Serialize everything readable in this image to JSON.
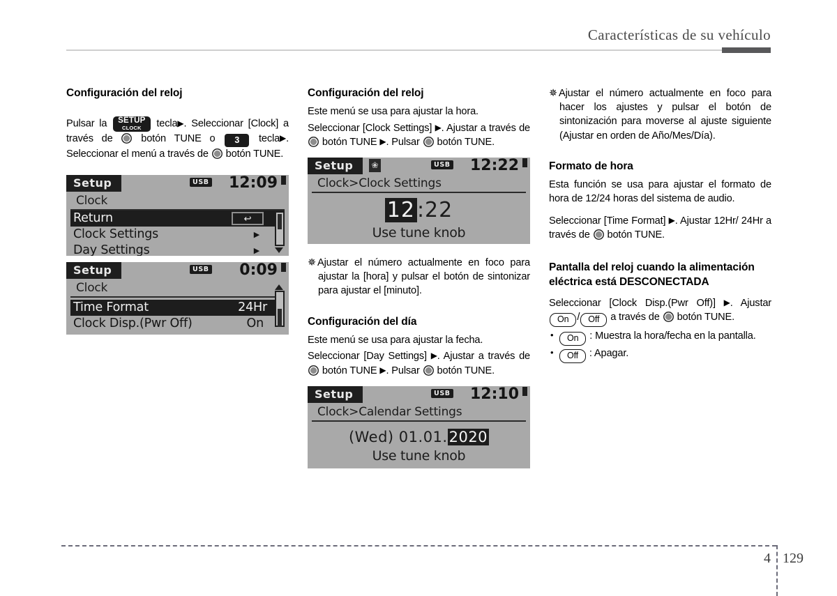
{
  "header": {
    "title": "Características de su vehículo"
  },
  "footer": {
    "chapter": "4",
    "page": "129"
  },
  "col1": {
    "heading": "Configuración del reloj",
    "para_pre": "Pulsar la",
    "key_setup_line1": "SETUP",
    "key_setup_line2": "CLOCK",
    "para_mid1": "tecla",
    "para_mid2": ". Seleccionar [Clock] a través de",
    "para_mid3": "botón TUNE o",
    "key_num": "3",
    "para_mid4": "tecla",
    "para_mid5": ". Seleccionar el menú a través de",
    "para_end": "botón TUNE."
  },
  "lcd1": {
    "title": "Setup",
    "usb": "USB",
    "clock": "12:09",
    "path": "Clock",
    "rows": [
      {
        "label": "Return",
        "value": "↩",
        "selected": true
      },
      {
        "label": "Clock Settings",
        "value": "▶",
        "selected": false
      },
      {
        "label": "Day Settings",
        "value": "▶",
        "selected": false
      }
    ]
  },
  "lcd2": {
    "title": "Setup",
    "usb": "USB",
    "clock": "0:09",
    "path": "Clock",
    "rows": [
      {
        "label": "Time Format",
        "value": "24Hr",
        "selected": true
      },
      {
        "label": "Clock Disp.(Pwr Off)",
        "value": "On",
        "selected": false
      }
    ]
  },
  "col2": {
    "heading1": "Configuración del reloj",
    "p1": "Este menú se usa para ajustar la hora.",
    "p2_a": "Seleccionar [Clock Settings]",
    "p2_b": ". Ajustar a través de",
    "p2_c": "botón TUNE",
    "p2_d": ". Pulsar",
    "p2_e": "botón TUNE.",
    "note1": "Ajustar el número actualmente en foco para ajustar la [hora] y pulsar el botón de sintonizar para ajustar el [minuto].",
    "heading2": "Configuración del día",
    "p3": "Este menú se usa para ajustar la fecha.",
    "p4_a": "Seleccionar [Day Settings]",
    "p4_b": ". Ajustar a través de",
    "p4_c": "botón TUNE",
    "p4_d": ". Pulsar",
    "p4_e": "botón TUNE."
  },
  "lcd3": {
    "title": "Setup",
    "bluetooth": "bluetooth-icon",
    "usb": "USB",
    "clock": "12:22",
    "path": "Clock>Clock Settings",
    "time_highlight": "12",
    "time_rest": ":22",
    "hint": "Use tune knob"
  },
  "lcd4": {
    "title": "Setup",
    "usb": "USB",
    "clock": "12:10",
    "path": "Clock>Calendar Settings",
    "date_prefix": "(Wed) 01.01.",
    "date_highlight": "2020",
    "hint": "Use tune knob"
  },
  "col3": {
    "note1": "Ajustar el número actualmente en foco para hacer los ajustes y pulsar el botón de sintonización para moverse al ajuste siguiente (Ajustar en orden de Año/Mes/Día).",
    "heading1": "Formato de hora",
    "p1": "Esta función se usa para ajustar el formato de hora de 12/24 horas del sistema de audio.",
    "p2_a": "Seleccionar [Time Format]",
    "p2_b": ". Ajustar 12Hr/ 24Hr a través de",
    "p2_c": "botón TUNE.",
    "heading2": "Pantalla del reloj cuando la alimentación eléctrica está DESCONECTADA",
    "p3_a": "Seleccionar [Clock Disp.(Pwr Off)]",
    "p3_b": ". Ajustar",
    "pill_on": "On",
    "p3_c": "/",
    "pill_off": "Off",
    "p3_d": "a través de",
    "p3_e": "botón TUNE.",
    "bullet1_label": "On",
    "bullet1_text": ": Muestra la hora/fecha en la pantalla.",
    "bullet2_label": "Off",
    "bullet2_text": ": Apagar."
  }
}
